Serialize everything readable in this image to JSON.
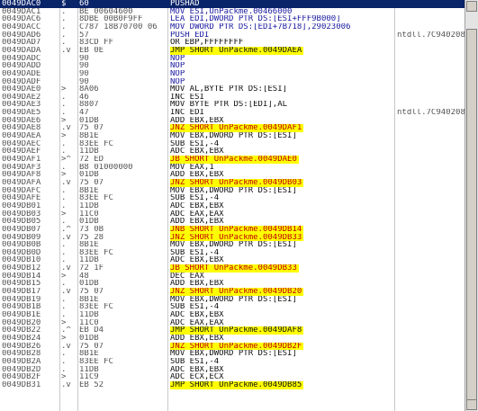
{
  "rows": [
    {
      "addr": "0049DAC0",
      "mark": "$",
      "hex": "60",
      "dis": "PUSHAD",
      "comment": "",
      "style": "selected"
    },
    {
      "addr": "0049DAC1",
      "mark": ".",
      "hex": "BE 00604600",
      "dis": "MOV ESI,UnPackme.00466000",
      "comment": "",
      "style": "blue"
    },
    {
      "addr": "0049DAC6",
      "mark": ".",
      "hex": "8DBE 00B0F9FF",
      "dis": "LEA EDI,DWORD PTR DS:[ESI+FFF9B000]",
      "comment": "",
      "style": "blue"
    },
    {
      "addr": "0049DACC",
      "mark": ".",
      "hex": "C787 18B70700 06",
      "dis": "MOV DWORD PTR DS:[EDI+7B718],29023006",
      "comment": "",
      "style": "blue"
    },
    {
      "addr": "0049DAD6",
      "mark": ".",
      "hex": "57",
      "dis": "PUSH EDI",
      "comment": "ntdll.7C940208",
      "style": "blue"
    },
    {
      "addr": "0049DAD7",
      "mark": ".",
      "hex": "83CD FF",
      "dis": "OR EBP,FFFFFFFF",
      "comment": "",
      "style": ""
    },
    {
      "addr": "0049DADA",
      "mark": ".v",
      "hex": "EB 0E",
      "dis": "JMP SHORT UnPackme.0049DAEA",
      "comment": "",
      "style": "jmp"
    },
    {
      "addr": "0049DADC",
      "mark": "",
      "hex": "90",
      "dis": "NOP",
      "comment": "",
      "style": "blue"
    },
    {
      "addr": "0049DADD",
      "mark": "",
      "hex": "90",
      "dis": "NOP",
      "comment": "",
      "style": "blue"
    },
    {
      "addr": "0049DADE",
      "mark": "",
      "hex": "90",
      "dis": "NOP",
      "comment": "",
      "style": "blue"
    },
    {
      "addr": "0049DADF",
      "mark": "",
      "hex": "90",
      "dis": "NOP",
      "comment": "",
      "style": "blue"
    },
    {
      "addr": "0049DAE0",
      "mark": ">",
      "hex": "8A06",
      "dis": "MOV AL,BYTE PTR DS:[ESI]",
      "comment": "",
      "style": ""
    },
    {
      "addr": "0049DAE2",
      "mark": ".",
      "hex": "46",
      "dis": "INC ESI",
      "comment": "",
      "style": ""
    },
    {
      "addr": "0049DAE3",
      "mark": ".",
      "hex": "8807",
      "dis": "MOV BYTE PTR DS:[EDI],AL",
      "comment": "",
      "style": ""
    },
    {
      "addr": "0049DAE5",
      "mark": ".",
      "hex": "47",
      "dis": "INC EDI",
      "comment": "ntdll.7C940208",
      "style": ""
    },
    {
      "addr": "0049DAE6",
      "mark": ">",
      "hex": "01DB",
      "dis": "ADD EBX,EBX",
      "comment": "",
      "style": ""
    },
    {
      "addr": "0049DAE8",
      "mark": ".v",
      "hex": "75 07",
      "dis": "JNZ SHORT UnPackme.0049DAF1",
      "comment": "",
      "style": "jcc"
    },
    {
      "addr": "0049DAEA",
      "mark": ">",
      "hex": "8B1E",
      "dis": "MOV EBX,DWORD PTR DS:[ESI]",
      "comment": "",
      "style": ""
    },
    {
      "addr": "0049DAEC",
      "mark": ".",
      "hex": "83EE FC",
      "dis": "SUB ESI,-4",
      "comment": "",
      "style": ""
    },
    {
      "addr": "0049DAEF",
      "mark": ".",
      "hex": "11DB",
      "dis": "ADC EBX,EBX",
      "comment": "",
      "style": ""
    },
    {
      "addr": "0049DAF1",
      "mark": ">^",
      "hex": "72 ED",
      "dis": "JB SHORT UnPackme.0049DAE0",
      "comment": "",
      "style": "jcc"
    },
    {
      "addr": "0049DAF3",
      "mark": ".",
      "hex": "B8 01000000",
      "dis": "MOV EAX,1",
      "comment": "",
      "style": ""
    },
    {
      "addr": "0049DAF8",
      "mark": ">",
      "hex": "01DB",
      "dis": "ADD EBX,EBX",
      "comment": "",
      "style": ""
    },
    {
      "addr": "0049DAFA",
      "mark": ".v",
      "hex": "75 07",
      "dis": "JNZ SHORT UnPackme.0049DB03",
      "comment": "",
      "style": "jcc"
    },
    {
      "addr": "0049DAFC",
      "mark": ".",
      "hex": "8B1E",
      "dis": "MOV EBX,DWORD PTR DS:[ESI]",
      "comment": "",
      "style": ""
    },
    {
      "addr": "0049DAFE",
      "mark": ".",
      "hex": "83EE FC",
      "dis": "SUB ESI,-4",
      "comment": "",
      "style": ""
    },
    {
      "addr": "0049DB01",
      "mark": ".",
      "hex": "11DB",
      "dis": "ADC EBX,EBX",
      "comment": "",
      "style": ""
    },
    {
      "addr": "0049DB03",
      "mark": ">",
      "hex": "11C0",
      "dis": "ADC EAX,EAX",
      "comment": "",
      "style": ""
    },
    {
      "addr": "0049DB05",
      "mark": ".",
      "hex": "01DB",
      "dis": "ADD EBX,EBX",
      "comment": "",
      "style": ""
    },
    {
      "addr": "0049DB07",
      "mark": ".^",
      "hex": "73 0B",
      "dis": "JNB SHORT UnPackme.0049DB14",
      "comment": "",
      "style": "jcc"
    },
    {
      "addr": "0049DB09",
      "mark": ".v",
      "hex": "75 28",
      "dis": "JNZ SHORT UnPackme.0049DB33",
      "comment": "",
      "style": "jcc"
    },
    {
      "addr": "0049DB0B",
      "mark": ".",
      "hex": "8B1E",
      "dis": "MOV EBX,DWORD PTR DS:[ESI]",
      "comment": "",
      "style": ""
    },
    {
      "addr": "0049DB0D",
      "mark": ".",
      "hex": "83EE FC",
      "dis": "SUB ESI,-4",
      "comment": "",
      "style": ""
    },
    {
      "addr": "0049DB10",
      "mark": ".",
      "hex": "11DB",
      "dis": "ADC EBX,EBX",
      "comment": "",
      "style": ""
    },
    {
      "addr": "0049DB12",
      "mark": ".v",
      "hex": "72 1F",
      "dis": "JB SHORT UnPackme.0049DB33",
      "comment": "",
      "style": "jcc"
    },
    {
      "addr": "0049DB14",
      "mark": ">",
      "hex": "48",
      "dis": "DEC EAX",
      "comment": "",
      "style": ""
    },
    {
      "addr": "0049DB15",
      "mark": ".",
      "hex": "01DB",
      "dis": "ADD EBX,EBX",
      "comment": "",
      "style": ""
    },
    {
      "addr": "0049DB17",
      "mark": ".v",
      "hex": "75 07",
      "dis": "JNZ SHORT UnPackme.0049DB20",
      "comment": "",
      "style": "jcc"
    },
    {
      "addr": "0049DB19",
      "mark": ".",
      "hex": "8B1E",
      "dis": "MOV EBX,DWORD PTR DS:[ESI]",
      "comment": "",
      "style": ""
    },
    {
      "addr": "0049DB1B",
      "mark": ".",
      "hex": "83EE FC",
      "dis": "SUB ESI,-4",
      "comment": "",
      "style": ""
    },
    {
      "addr": "0049DB1E",
      "mark": ".",
      "hex": "11DB",
      "dis": "ADC EBX,EBX",
      "comment": "",
      "style": ""
    },
    {
      "addr": "0049DB20",
      "mark": ">",
      "hex": "11C0",
      "dis": "ADC EAX,EAX",
      "comment": "",
      "style": ""
    },
    {
      "addr": "0049DB22",
      "mark": ".^",
      "hex": "EB D4",
      "dis": "JMP SHORT UnPackme.0049DAF8",
      "comment": "",
      "style": "jmp"
    },
    {
      "addr": "0049DB24",
      "mark": ">",
      "hex": "01DB",
      "dis": "ADD EBX,EBX",
      "comment": "",
      "style": ""
    },
    {
      "addr": "0049DB26",
      "mark": ".v",
      "hex": "75 07",
      "dis": "JNZ SHORT UnPackme.0049DB2F",
      "comment": "",
      "style": "jcc"
    },
    {
      "addr": "0049DB28",
      "mark": ".",
      "hex": "8B1E",
      "dis": "MOV EBX,DWORD PTR DS:[ESI]",
      "comment": "",
      "style": ""
    },
    {
      "addr": "0049DB2A",
      "mark": ".",
      "hex": "83EE FC",
      "dis": "SUB ESI,-4",
      "comment": "",
      "style": ""
    },
    {
      "addr": "0049DB2D",
      "mark": ".",
      "hex": "11DB",
      "dis": "ADC EBX,EBX",
      "comment": "",
      "style": ""
    },
    {
      "addr": "0049DB2F",
      "mark": ">",
      "hex": "11C9",
      "dis": "ADC ECX,ECX",
      "comment": "",
      "style": ""
    },
    {
      "addr": "0049DB31",
      "mark": ".v",
      "hex": "EB 52",
      "dis": "JMP SHORT UnPackme.0049DB85",
      "comment": "",
      "style": "jmp"
    }
  ]
}
